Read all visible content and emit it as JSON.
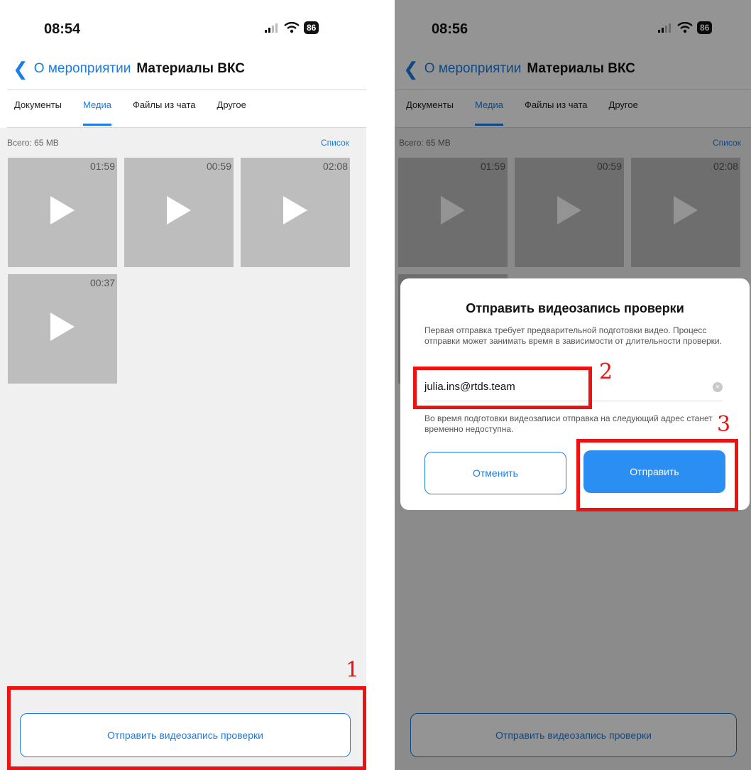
{
  "screen1": {
    "time": "08:54",
    "battery": "86",
    "back_label": "О мероприятии",
    "title": "Материалы ВКС",
    "tabs": [
      {
        "label": "Документы"
      },
      {
        "label": "Медиа"
      },
      {
        "label": "Файлы из чата"
      },
      {
        "label": "Другое"
      }
    ],
    "total": "Всего: 65 MB",
    "list_link": "Список",
    "videos": [
      {
        "duration": "01:59"
      },
      {
        "duration": "00:59"
      },
      {
        "duration": "02:08"
      },
      {
        "duration": "00:37"
      }
    ],
    "send_button": "Отправить видеозапись проверки"
  },
  "screen2": {
    "time": "08:56",
    "battery": "86",
    "back_label": "О мероприятии",
    "title": "Материалы ВКС",
    "tabs": [
      {
        "label": "Документы"
      },
      {
        "label": "Медиа"
      },
      {
        "label": "Файлы из чата"
      },
      {
        "label": "Другое"
      }
    ],
    "total": "Всего: 65 MB",
    "list_link": "Список",
    "videos": [
      {
        "duration": "01:59"
      },
      {
        "duration": "00:59"
      },
      {
        "duration": "02:08"
      }
    ],
    "send_button": "Отправить видеозапись проверки",
    "dialog": {
      "title": "Отправить видеозапись проверки",
      "description": "Первая отправка требует предварительной подготовки видео. Процесс отправки может занимать время в зависимости от длительности проверки.",
      "email": "julia.ins@rtds.team",
      "note": "Во время подготовки видеозаписи отправка на следующий адрес станет временно недоступна.",
      "cancel": "Отменить",
      "send": "Отправить"
    }
  },
  "annotations": [
    "1",
    "2",
    "3"
  ],
  "colors": {
    "accent": "#1a7ee6",
    "annotation": "#ee1111",
    "send_button": "#2b8ef2"
  },
  "icons": [
    "back-chevron-icon",
    "signal-icon",
    "wifi-icon",
    "battery-icon",
    "play-icon",
    "clear-icon"
  ]
}
